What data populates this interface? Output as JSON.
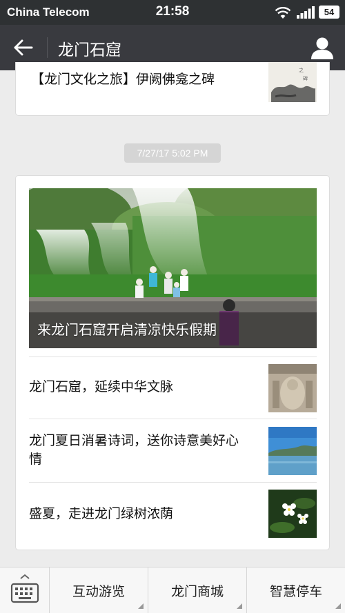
{
  "status_bar": {
    "carrier": "China Telecom",
    "time": "21:58",
    "battery": "54",
    "icons": [
      "wifi-icon",
      "signal-icon",
      "battery-icon"
    ]
  },
  "title_bar": {
    "title": "龙门石窟",
    "back_icon": "back-arrow-icon",
    "profile_icon": "person-icon"
  },
  "previous_message": {
    "title": "【龙门文化之旅】伊阙佛龛之碑"
  },
  "timestamp": "7/27/17 5:02 PM",
  "article_card": {
    "hero_caption": "来龙门石窟开启清凉快乐假期",
    "items": [
      {
        "title": "龙门石窟，延续中华文脉"
      },
      {
        "title": "龙门夏日消暑诗词，送你诗意美好心情"
      },
      {
        "title": "盛夏，走进龙门绿树浓荫"
      }
    ]
  },
  "bottom_menu": {
    "keyboard_icon": "keyboard-icon",
    "items": [
      "互动游览",
      "龙门商城",
      "智慧停车"
    ]
  },
  "colors": {
    "status_bar": "#2e3133",
    "title_bar": "#393a3f",
    "background": "#ececec",
    "timestamp_bg": "#d5d5d5"
  }
}
